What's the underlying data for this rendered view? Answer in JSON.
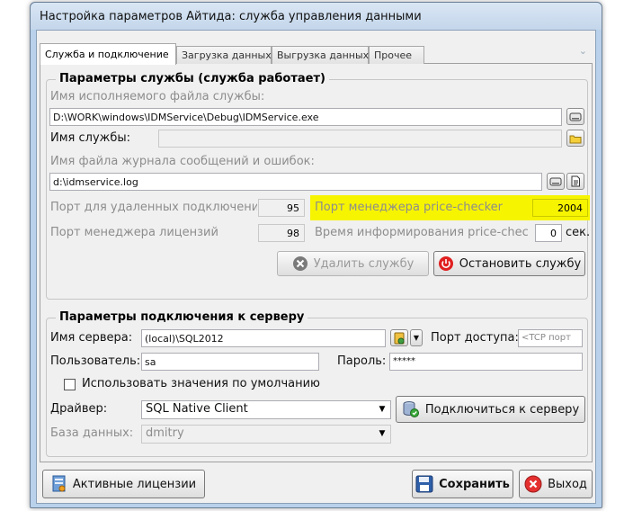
{
  "window": {
    "title": "Настройка параметров Айтида: служба управления данными"
  },
  "tabs": [
    {
      "label": "Служба и подключение",
      "active": true
    },
    {
      "label": "Загрузка данных",
      "active": false
    },
    {
      "label": "Выгрузка данных",
      "active": false
    },
    {
      "label": "Прочее",
      "active": false
    }
  ],
  "service": {
    "legend": "Параметры службы (служба работает)",
    "exe_label": "Имя исполняемого файла службы:",
    "exe_value": "D:\\WORK\\windows\\IDMService\\Debug\\IDMService.exe",
    "name_label": "Имя службы:",
    "name_value": "",
    "log_label": "Имя файла журнала сообщений и ошибок:",
    "log_value": "d:\\idmservice.log",
    "remote_port_label": "Порт для удаленных подключени",
    "remote_port_value": "95",
    "checker_port_label": "Порт менеджера price-checker",
    "checker_port_value": "2004",
    "license_port_label": "Порт менеджера лицензий",
    "license_port_value": "98",
    "inform_time_label": "Время информирования price-chec",
    "inform_time_value": "0",
    "inform_time_unit": "сек.",
    "delete_button": "Удалить службу",
    "stop_button": "Остановить службу",
    "highlight_color": "#f7f400"
  },
  "connection": {
    "legend": "Параметры подключения к серверу",
    "server_label": "Имя сервера:",
    "server_value": "(local)\\SQL2012",
    "port_label": "Порт доступа:",
    "port_placeholder": "<TCP порт",
    "user_label": "Пользователь:",
    "user_value": "sa",
    "password_label": "Пароль:",
    "password_value": "*****",
    "defaults_checkbox": "Использовать значения по умолчанию",
    "defaults_checked": false,
    "driver_label": "Драйвер:",
    "driver_value": "SQL Native Client",
    "connect_button": "Подключиться к серверу",
    "db_label": "База данных:",
    "db_value": "dmitry"
  },
  "footer": {
    "licenses_button": "Активные лицензии",
    "save_button": "Сохранить",
    "exit_button": "Выход"
  }
}
